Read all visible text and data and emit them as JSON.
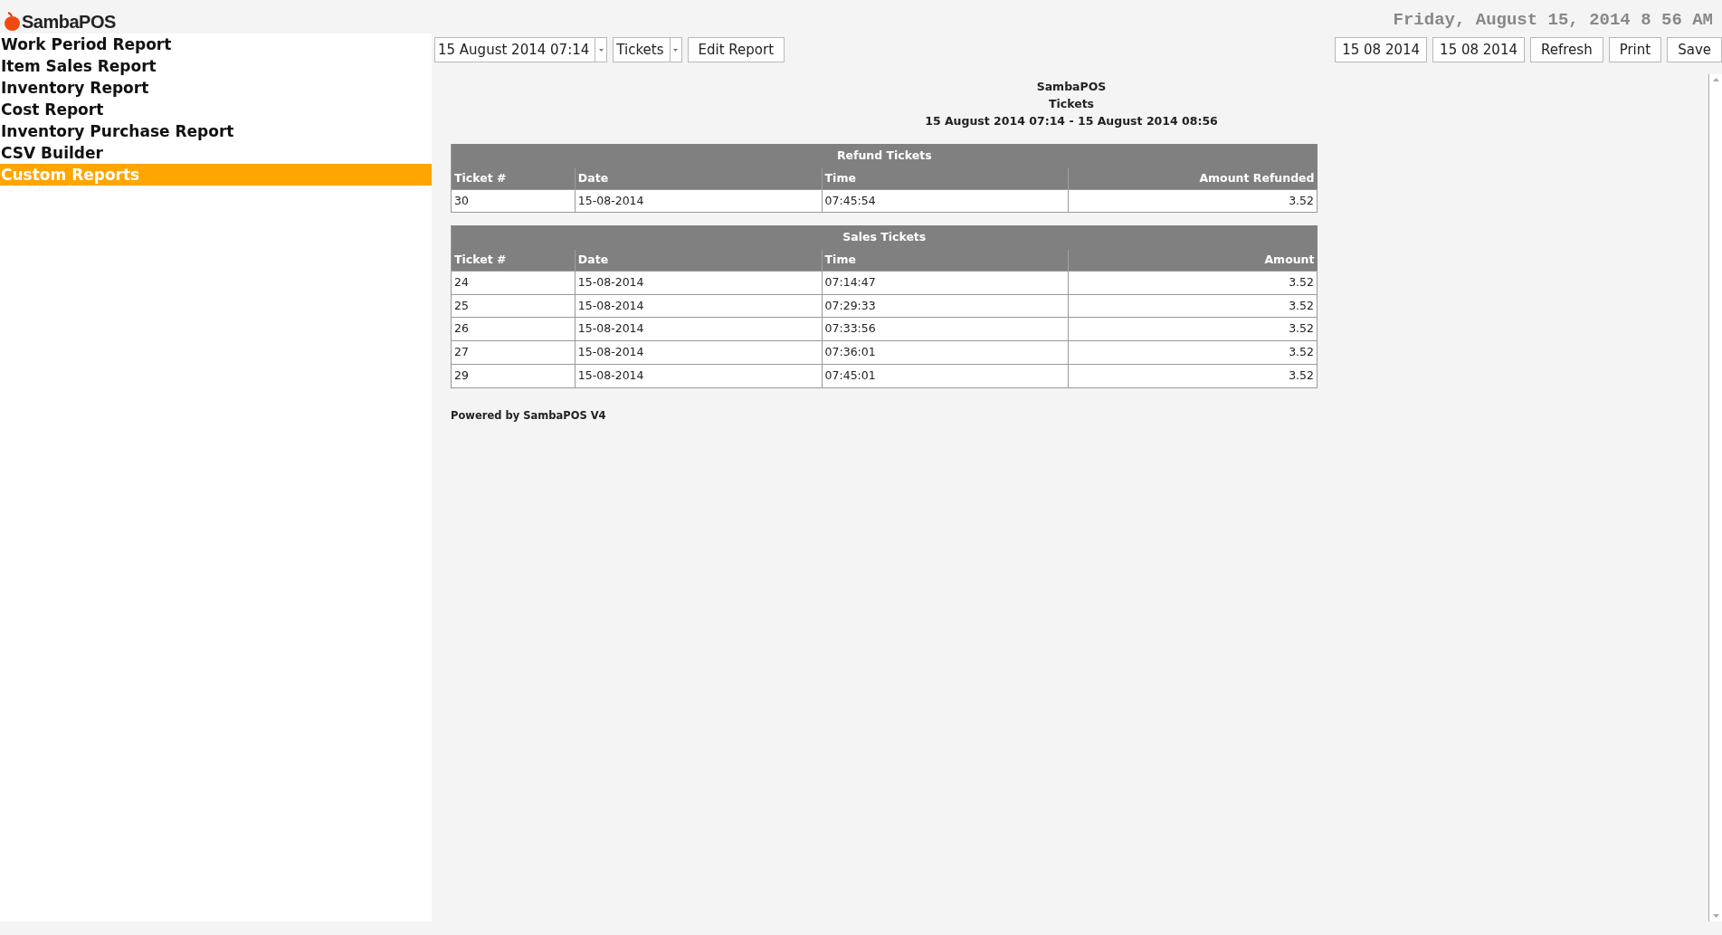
{
  "app": {
    "logo_text": "SambaPOS",
    "clock": "Friday, August 15, 2014 8 56 AM"
  },
  "sidebar": {
    "items": [
      {
        "label": "Work Period Report",
        "selected": false
      },
      {
        "label": "Item Sales Report",
        "selected": false
      },
      {
        "label": "Inventory Report",
        "selected": false
      },
      {
        "label": "Cost Report",
        "selected": false
      },
      {
        "label": "Inventory Purchase Report",
        "selected": false
      },
      {
        "label": "CSV Builder",
        "selected": false
      },
      {
        "label": "Custom Reports",
        "selected": true
      }
    ]
  },
  "toolbar": {
    "period_dropdown": {
      "value": "15 August 2014 07:14"
    },
    "report_dropdown": {
      "value": "Tickets"
    },
    "left_buttons": [
      "Edit Report"
    ],
    "start_date": "15 08 2014",
    "end_date": "15 08 2014",
    "right_buttons": [
      "Refresh",
      "Print",
      "Save"
    ]
  },
  "report": {
    "header_lines": [
      "SambaPOS",
      "Tickets",
      "15 August 2014 07:14 - 15 August 2014 08:56"
    ],
    "tables": [
      {
        "title": "Refund Tickets",
        "columns": [
          "Ticket #",
          "Date",
          "Time",
          "Amount Refunded"
        ],
        "rows": [
          [
            "30",
            "15-08-2014",
            "07:45:54",
            "3.52"
          ]
        ]
      },
      {
        "title": "Sales Tickets",
        "columns": [
          "Ticket #",
          "Date",
          "Time",
          "Amount"
        ],
        "rows": [
          [
            "24",
            "15-08-2014",
            "07:14:47",
            "3.52"
          ],
          [
            "25",
            "15-08-2014",
            "07:29:33",
            "3.52"
          ],
          [
            "26",
            "15-08-2014",
            "07:33:56",
            "3.52"
          ],
          [
            "27",
            "15-08-2014",
            "07:36:01",
            "3.52"
          ],
          [
            "29",
            "15-08-2014",
            "07:45:01",
            "3.52"
          ]
        ]
      }
    ],
    "footer": "Powered by SambaPOS V4"
  }
}
